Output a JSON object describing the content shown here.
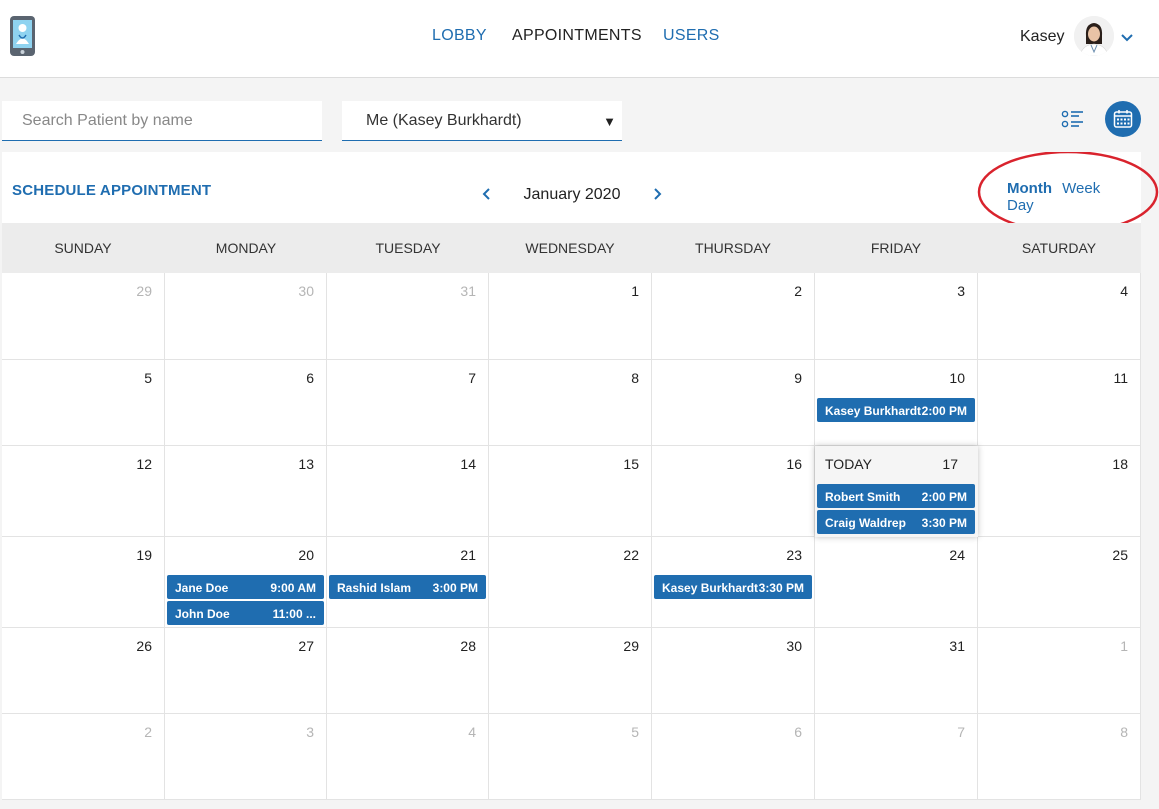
{
  "header": {
    "nav": {
      "lobby": "LOBBY",
      "appointments": "APPOINTMENTS",
      "users": "USERS"
    },
    "user_name": "Kasey"
  },
  "filters": {
    "search_placeholder": "Search Patient by name",
    "provider_selected": "Me (Kasey Burkhardt)",
    "select_arrow": "▼"
  },
  "calendar": {
    "schedule_label": "SCHEDULE APPOINTMENT",
    "month_title": "January 2020",
    "view_tabs": {
      "month": "Month",
      "week": "Week",
      "day": "Day"
    },
    "active_view": "Month",
    "weekdays": [
      "SUNDAY",
      "MONDAY",
      "TUESDAY",
      "WEDNESDAY",
      "THURSDAY",
      "FRIDAY",
      "SATURDAY"
    ],
    "today_label": "TODAY",
    "weeks": [
      [
        "29",
        "30",
        "31",
        "1",
        "2",
        "3",
        "4"
      ],
      [
        "5",
        "6",
        "7",
        "8",
        "9",
        "10",
        "11"
      ],
      [
        "12",
        "13",
        "14",
        "15",
        "16",
        "17",
        "18"
      ],
      [
        "19",
        "20",
        "21",
        "22",
        "23",
        "24",
        "25"
      ],
      [
        "26",
        "27",
        "28",
        "29",
        "30",
        "31",
        "1"
      ],
      [
        "2",
        "3",
        "4",
        "5",
        "6",
        "7",
        "8"
      ]
    ],
    "events": {
      "jan10": [
        {
          "name": "Kasey Burkhardt",
          "time": "2:00 PM"
        }
      ],
      "jan17": [
        {
          "name": "Robert Smith",
          "time": "2:00 PM"
        },
        {
          "name": "Craig Waldrep",
          "time": "3:30 PM"
        }
      ],
      "jan20": [
        {
          "name": "Jane Doe",
          "time": "9:00 AM"
        },
        {
          "name": "John Doe",
          "time": "11:00 ..."
        }
      ],
      "jan21": [
        {
          "name": "Rashid Islam",
          "time": "3:00 PM"
        }
      ],
      "jan23": [
        {
          "name": "Kasey Burkhardt",
          "time": "3:30 PM"
        }
      ]
    }
  },
  "colors": {
    "accent": "#1f6db0",
    "highlight_ring": "#d9232d"
  }
}
